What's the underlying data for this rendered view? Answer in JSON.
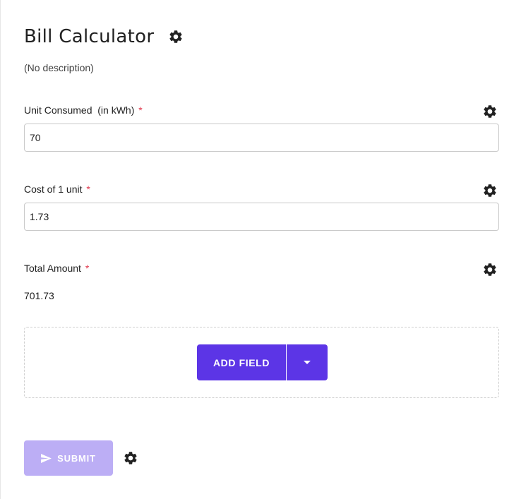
{
  "form": {
    "title": "Bill Calculator",
    "description": "(No description)"
  },
  "fields": [
    {
      "label": "Unit Consumed  (in kWh)",
      "required_mark": "*",
      "value": "70",
      "type": "input"
    },
    {
      "label": "Cost of 1 unit",
      "required_mark": "*",
      "value": "1.73",
      "type": "input"
    },
    {
      "label": "Total Amount",
      "required_mark": "*",
      "value": "701.73",
      "type": "computed"
    }
  ],
  "add_field": {
    "label": "ADD FIELD"
  },
  "submit": {
    "label": "SUBMIT"
  },
  "icons": {
    "settings": "gear-icon",
    "send": "send-icon",
    "dropdown": "caret-down-icon"
  },
  "colors": {
    "primary": "#5c35e6",
    "submit_disabled": "#bcaef5",
    "required": "#e0394e",
    "border": "#c9c9c9"
  }
}
